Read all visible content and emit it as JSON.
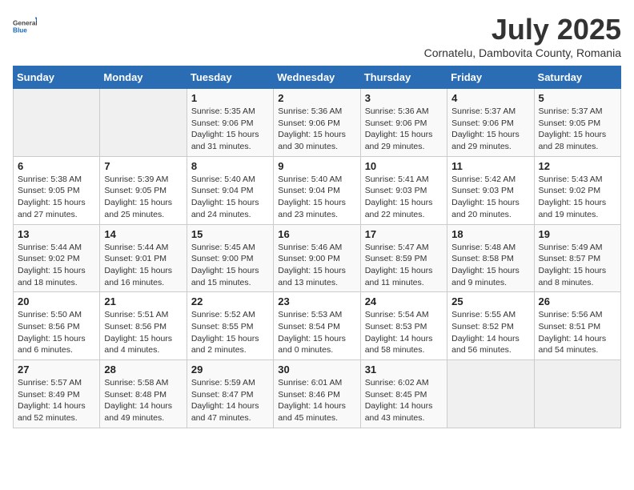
{
  "header": {
    "logo_general": "General",
    "logo_blue": "Blue",
    "month_year": "July 2025",
    "location": "Cornatelu, Dambovita County, Romania"
  },
  "weekdays": [
    "Sunday",
    "Monday",
    "Tuesday",
    "Wednesday",
    "Thursday",
    "Friday",
    "Saturday"
  ],
  "weeks": [
    [
      {
        "day": "",
        "empty": true
      },
      {
        "day": "",
        "empty": true
      },
      {
        "day": "1",
        "sunrise": "5:35 AM",
        "sunset": "9:06 PM",
        "daylight": "15 hours and 31 minutes."
      },
      {
        "day": "2",
        "sunrise": "5:36 AM",
        "sunset": "9:06 PM",
        "daylight": "15 hours and 30 minutes."
      },
      {
        "day": "3",
        "sunrise": "5:36 AM",
        "sunset": "9:06 PM",
        "daylight": "15 hours and 29 minutes."
      },
      {
        "day": "4",
        "sunrise": "5:37 AM",
        "sunset": "9:06 PM",
        "daylight": "15 hours and 29 minutes."
      },
      {
        "day": "5",
        "sunrise": "5:37 AM",
        "sunset": "9:05 PM",
        "daylight": "15 hours and 28 minutes."
      }
    ],
    [
      {
        "day": "6",
        "sunrise": "5:38 AM",
        "sunset": "9:05 PM",
        "daylight": "15 hours and 27 minutes."
      },
      {
        "day": "7",
        "sunrise": "5:39 AM",
        "sunset": "9:05 PM",
        "daylight": "15 hours and 25 minutes."
      },
      {
        "day": "8",
        "sunrise": "5:40 AM",
        "sunset": "9:04 PM",
        "daylight": "15 hours and 24 minutes."
      },
      {
        "day": "9",
        "sunrise": "5:40 AM",
        "sunset": "9:04 PM",
        "daylight": "15 hours and 23 minutes."
      },
      {
        "day": "10",
        "sunrise": "5:41 AM",
        "sunset": "9:03 PM",
        "daylight": "15 hours and 22 minutes."
      },
      {
        "day": "11",
        "sunrise": "5:42 AM",
        "sunset": "9:03 PM",
        "daylight": "15 hours and 20 minutes."
      },
      {
        "day": "12",
        "sunrise": "5:43 AM",
        "sunset": "9:02 PM",
        "daylight": "15 hours and 19 minutes."
      }
    ],
    [
      {
        "day": "13",
        "sunrise": "5:44 AM",
        "sunset": "9:02 PM",
        "daylight": "15 hours and 18 minutes."
      },
      {
        "day": "14",
        "sunrise": "5:44 AM",
        "sunset": "9:01 PM",
        "daylight": "15 hours and 16 minutes."
      },
      {
        "day": "15",
        "sunrise": "5:45 AM",
        "sunset": "9:00 PM",
        "daylight": "15 hours and 15 minutes."
      },
      {
        "day": "16",
        "sunrise": "5:46 AM",
        "sunset": "9:00 PM",
        "daylight": "15 hours and 13 minutes."
      },
      {
        "day": "17",
        "sunrise": "5:47 AM",
        "sunset": "8:59 PM",
        "daylight": "15 hours and 11 minutes."
      },
      {
        "day": "18",
        "sunrise": "5:48 AM",
        "sunset": "8:58 PM",
        "daylight": "15 hours and 9 minutes."
      },
      {
        "day": "19",
        "sunrise": "5:49 AM",
        "sunset": "8:57 PM",
        "daylight": "15 hours and 8 minutes."
      }
    ],
    [
      {
        "day": "20",
        "sunrise": "5:50 AM",
        "sunset": "8:56 PM",
        "daylight": "15 hours and 6 minutes."
      },
      {
        "day": "21",
        "sunrise": "5:51 AM",
        "sunset": "8:56 PM",
        "daylight": "15 hours and 4 minutes."
      },
      {
        "day": "22",
        "sunrise": "5:52 AM",
        "sunset": "8:55 PM",
        "daylight": "15 hours and 2 minutes."
      },
      {
        "day": "23",
        "sunrise": "5:53 AM",
        "sunset": "8:54 PM",
        "daylight": "15 hours and 0 minutes."
      },
      {
        "day": "24",
        "sunrise": "5:54 AM",
        "sunset": "8:53 PM",
        "daylight": "14 hours and 58 minutes."
      },
      {
        "day": "25",
        "sunrise": "5:55 AM",
        "sunset": "8:52 PM",
        "daylight": "14 hours and 56 minutes."
      },
      {
        "day": "26",
        "sunrise": "5:56 AM",
        "sunset": "8:51 PM",
        "daylight": "14 hours and 54 minutes."
      }
    ],
    [
      {
        "day": "27",
        "sunrise": "5:57 AM",
        "sunset": "8:49 PM",
        "daylight": "14 hours and 52 minutes."
      },
      {
        "day": "28",
        "sunrise": "5:58 AM",
        "sunset": "8:48 PM",
        "daylight": "14 hours and 49 minutes."
      },
      {
        "day": "29",
        "sunrise": "5:59 AM",
        "sunset": "8:47 PM",
        "daylight": "14 hours and 47 minutes."
      },
      {
        "day": "30",
        "sunrise": "6:01 AM",
        "sunset": "8:46 PM",
        "daylight": "14 hours and 45 minutes."
      },
      {
        "day": "31",
        "sunrise": "6:02 AM",
        "sunset": "8:45 PM",
        "daylight": "14 hours and 43 minutes."
      },
      {
        "day": "",
        "empty": true
      },
      {
        "day": "",
        "empty": true
      }
    ]
  ]
}
